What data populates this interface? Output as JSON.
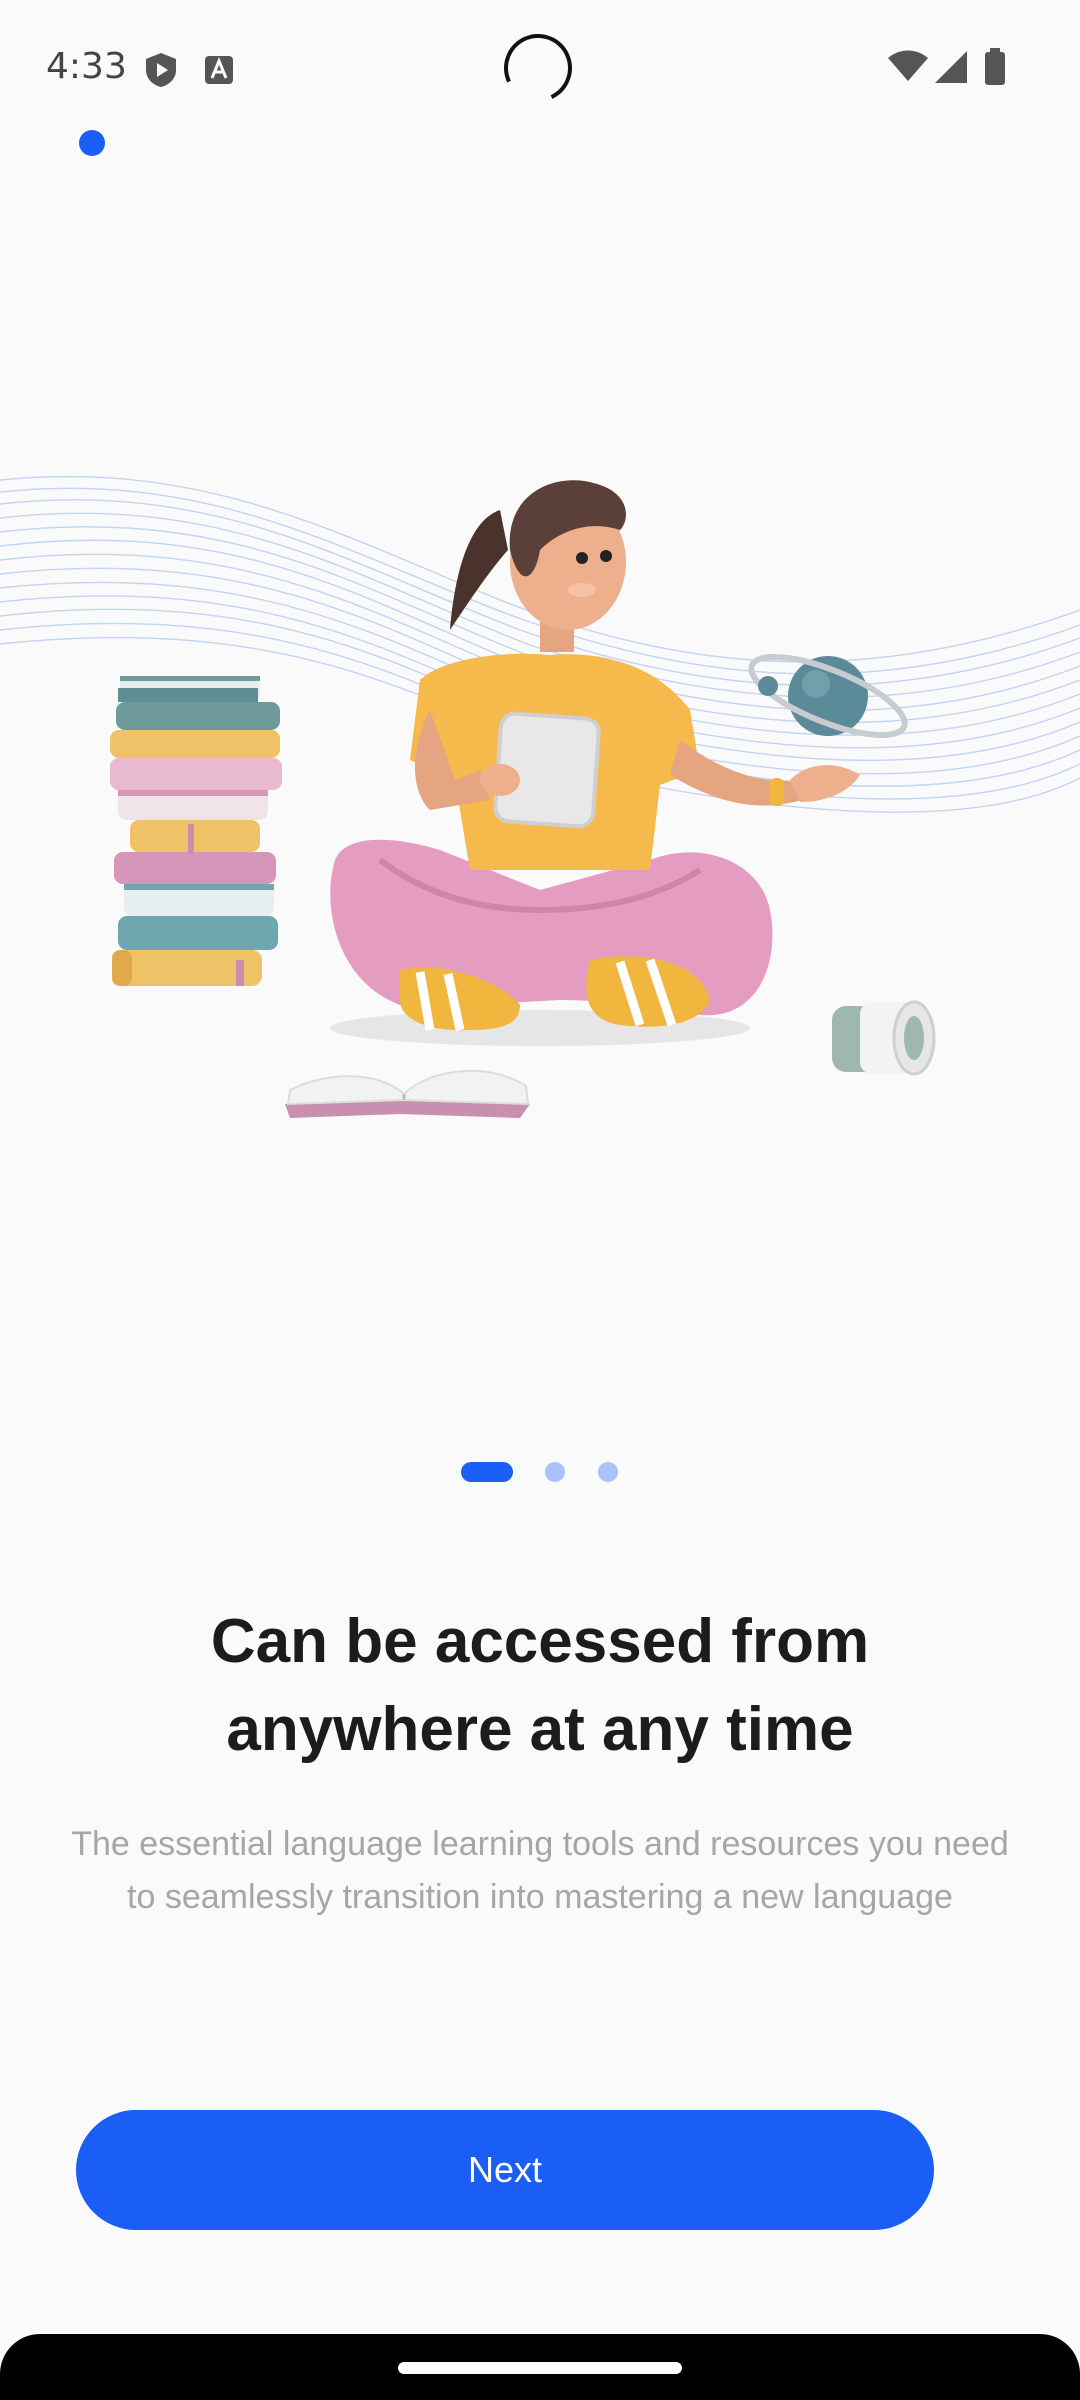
{
  "status_bar": {
    "time": "4:33",
    "icons": [
      "shield-play-icon",
      "text-a-icon",
      "wifi-icon",
      "cellular-signal-icon",
      "battery-icon"
    ]
  },
  "onboarding": {
    "page_indicator": {
      "total": 3,
      "active": 0
    },
    "title_line1": "Can be accessed from",
    "title_line2": "anywhere at any time",
    "description": "The essential language learning tools and resources you need to seamlessly transition into mastering a new language",
    "next_label": "Next"
  },
  "colors": {
    "accent": "#1a5ef6",
    "inactive_dot": "#a9c2f7",
    "background": "#fafafa",
    "title": "#1c1c1c",
    "description": "#a6a6a6"
  }
}
